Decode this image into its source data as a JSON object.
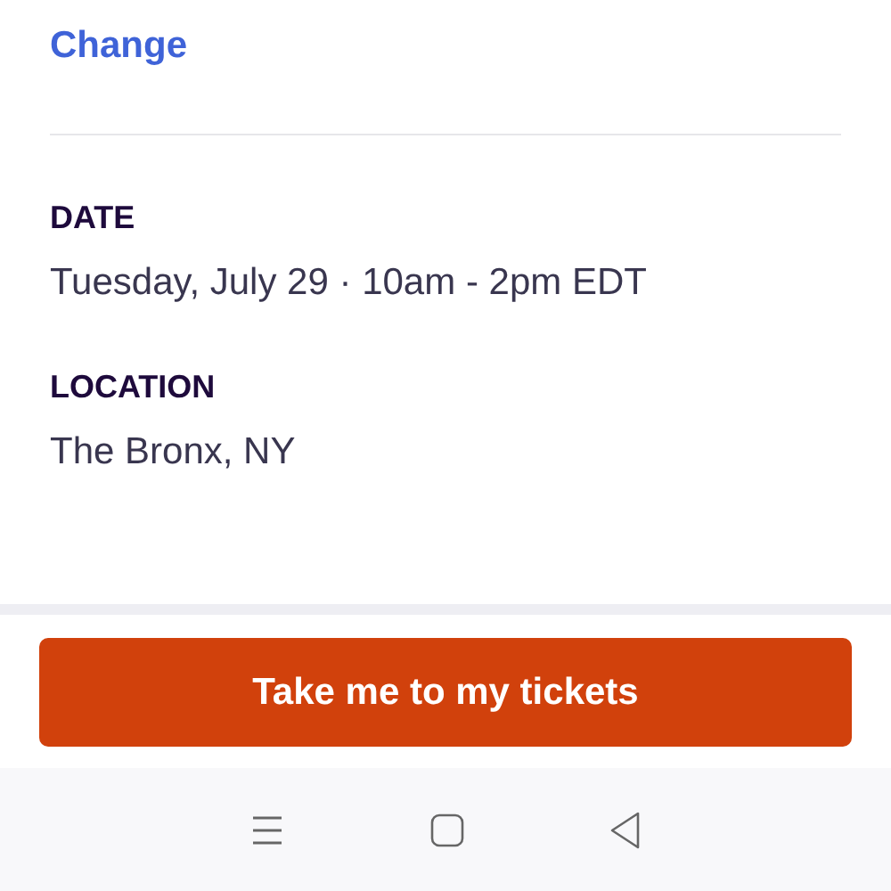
{
  "account": {
    "change_link": "Change"
  },
  "details": [
    {
      "label": "DATE",
      "value": "Tuesday, July 29 · 10am - 2pm EDT"
    },
    {
      "label": "LOCATION",
      "value": "The Bronx, NY"
    }
  ],
  "primary_button": "Take me to my tickets",
  "nav_bar": {
    "buttons": [
      {
        "kind": "menu"
      },
      {
        "kind": "home"
      },
      {
        "kind": "back"
      }
    ]
  }
}
